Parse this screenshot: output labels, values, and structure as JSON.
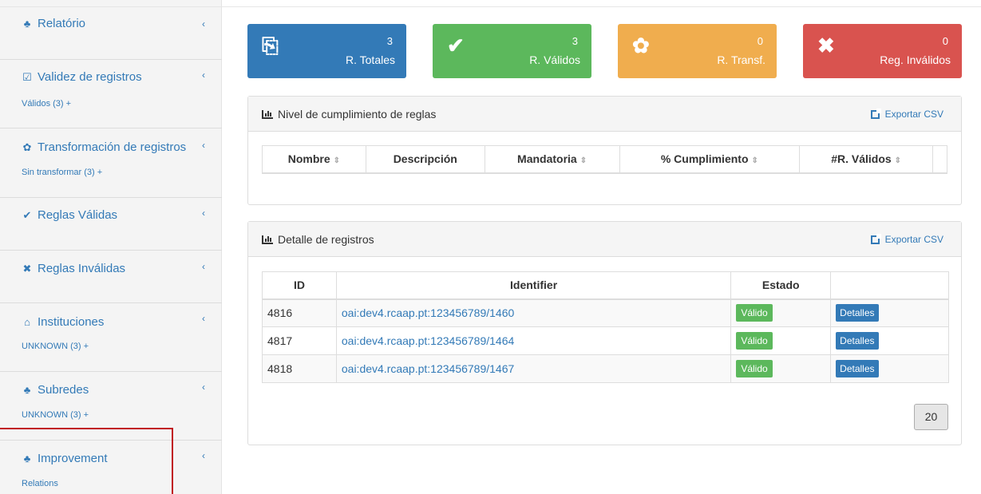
{
  "sidebar": {
    "items": [
      {
        "label": "Relatório",
        "icon": "sitemap-icon",
        "glyph": "♣",
        "sub": ""
      },
      {
        "label": "Validez de registros",
        "icon": "check-square-icon",
        "glyph": "☑",
        "sub": "Válidos (3) +"
      },
      {
        "label": "Transformación de registros",
        "icon": "gear-icon",
        "glyph": "✿",
        "sub": "Sin transformar (3) +"
      },
      {
        "label": "Reglas Válidas",
        "icon": "check-icon",
        "glyph": "✔",
        "sub": ""
      },
      {
        "label": "Reglas Inválidas",
        "icon": "times-icon",
        "glyph": "✖",
        "sub": ""
      },
      {
        "label": "Instituciones",
        "icon": "institution-icon",
        "glyph": "⌂",
        "sub": "UNKNOWN (3) +"
      },
      {
        "label": "Subredes",
        "icon": "sitemap-icon",
        "glyph": "♣",
        "sub": "UNKNOWN (3) +"
      },
      {
        "label": "Improvement",
        "icon": "sitemap-icon",
        "glyph": "♣",
        "sub": "Relations"
      }
    ],
    "chevron": "‹"
  },
  "stats": [
    {
      "value": "3",
      "label": "R. Totales",
      "icon": "copy-icon",
      "glyph": "⎘",
      "color": "#337ab7"
    },
    {
      "value": "3",
      "label": "R. Válidos",
      "icon": "check-icon",
      "glyph": "✔",
      "color": "#5cb85c"
    },
    {
      "value": "0",
      "label": "R. Transf.",
      "icon": "gears-icon",
      "glyph": "✿",
      "color": "#f0ad4e"
    },
    {
      "value": "0",
      "label": "Reg. Inválidos",
      "icon": "times-icon",
      "glyph": "✖",
      "color": "#d9534f"
    }
  ],
  "rules_panel": {
    "title": "Nivel de cumplimiento de reglas",
    "export_label": "Exportar CSV",
    "columns": [
      "Nombre",
      "Descripción",
      "Mandatoria",
      "% Cumplimiento",
      "#R. Válidos",
      ""
    ]
  },
  "records_panel": {
    "title": "Detalle de registros",
    "export_label": "Exportar CSV",
    "columns": [
      "ID",
      "Identifier",
      "Estado",
      ""
    ],
    "rows": [
      {
        "id": "4816",
        "identifier": "oai:dev4.rcaap.pt:123456789/1460",
        "status": "Válido",
        "action": "Detalles"
      },
      {
        "id": "4817",
        "identifier": "oai:dev4.rcaap.pt:123456789/1464",
        "status": "Válido",
        "action": "Detalles"
      },
      {
        "id": "4818",
        "identifier": "oai:dev4.rcaap.pt:123456789/1467",
        "status": "Válido",
        "action": "Detalles"
      }
    ],
    "page_size": "20"
  }
}
